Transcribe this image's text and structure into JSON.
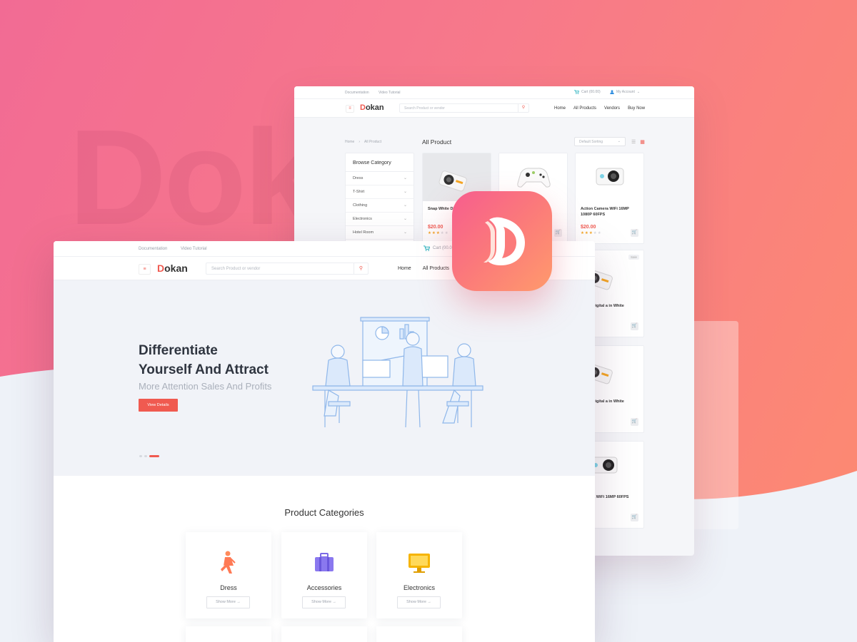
{
  "background": {
    "watermark_text": "Dok"
  },
  "colors": {
    "brand": "#f05a50",
    "star": "#f5a623",
    "gradient_start": "#f26b94",
    "gradient_end": "#fd8b6f"
  },
  "back_window": {
    "topbar": {
      "documentation": "Documentation",
      "video_tutorial": "Video Tutorial",
      "cart": "Cart (00.00)",
      "account": "My Account"
    },
    "header": {
      "menu_icon": "≡",
      "logo_letter": "D",
      "logo_rest": "okan",
      "search_placeholder": "Search Product or vendor",
      "nav": [
        "Home",
        "All Products",
        "Vendors",
        "Buy Now"
      ]
    },
    "breadcrumb": [
      "Home",
      "All Product"
    ],
    "page_title": "All Product",
    "sort_label": "Default Sorting",
    "category_panel": {
      "title": "Browse Category",
      "items": [
        "Dress",
        "T-Shirt",
        "Clothing",
        "Electronics",
        "Hotel Room"
      ]
    },
    "products": [
      {
        "name": "Snap White Digital Camera in White",
        "name_visible": "Snap White Di Camera in W",
        "price": "$20.00",
        "rating": 3,
        "icon": "action-camera"
      },
      {
        "name": "",
        "price": "",
        "rating": 0,
        "icon": "game-controller"
      },
      {
        "name": "Action Camera WiFi 16MP 1080P 60FPS",
        "price": "$20.00",
        "rating": 3,
        "icon": "round-camera"
      },
      {
        "name": "White Digital a in White",
        "price": "",
        "rating": 0,
        "badge": "Sale",
        "icon": "action-camera"
      },
      {
        "name": "White Digital a in White",
        "price": "",
        "rating": 0,
        "icon": "action-camera"
      },
      {
        "name": "Camera WiFi 16MP 60FPS",
        "price": "",
        "rating": 0,
        "icon": "round-camera"
      }
    ]
  },
  "front_window": {
    "topbar": {
      "documentation": "Documentation",
      "video_tutorial": "Video Tutorial",
      "cart": "Cart (00.0"
    },
    "header": {
      "menu_icon": "≡",
      "logo_letter": "D",
      "logo_rest": "okan",
      "search_placeholder": "Search Product or vendor",
      "nav": [
        "Home",
        "All Products"
      ]
    },
    "hero": {
      "title_line1": "Differentiate",
      "title_line2": "Yourself And Attract",
      "subtitle": "More Attention Sales And Profits",
      "button": "View Details",
      "slides_total": 3,
      "active_slide": 3
    },
    "categories_title": "Product Categories",
    "categories": [
      {
        "name": "Dress",
        "button": "Show More →",
        "icon": "dress-icon"
      },
      {
        "name": "Accessories",
        "button": "Show More →",
        "icon": "briefcase-icon"
      },
      {
        "name": "Electronics",
        "button": "Show More →",
        "icon": "monitor-icon"
      }
    ]
  },
  "app_icon": {
    "letter": "D"
  }
}
